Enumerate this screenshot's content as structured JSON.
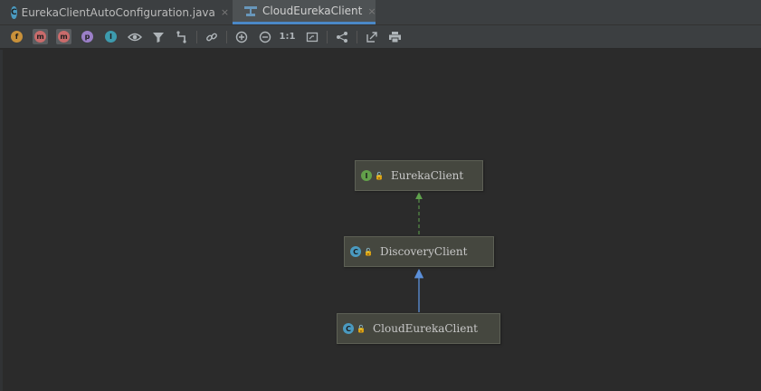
{
  "tabs": [
    {
      "label": "EurekaClientAutoConfiguration.java",
      "icon_letter": "C",
      "close": "×"
    },
    {
      "label": "CloudEurekaClient",
      "close": "×"
    }
  ],
  "toolbar": {
    "filters": [
      {
        "letter": "f",
        "color": "#c9913a"
      },
      {
        "letter": "m",
        "color": "#c96b6b"
      },
      {
        "letter": "m",
        "color": "#c96b6b"
      },
      {
        "letter": "p",
        "color": "#9b7fc8"
      },
      {
        "letter": "I",
        "color": "#3d9bae"
      }
    ],
    "actual_size_label": "1:1"
  },
  "diagram": {
    "nodes": [
      {
        "id": "EurekaClient",
        "name": "EurekaClient",
        "kind": "interface",
        "kind_letter": "I"
      },
      {
        "id": "DiscoveryClient",
        "name": "DiscoveryClient",
        "kind": "class",
        "kind_letter": "C"
      },
      {
        "id": "CloudEurekaClient",
        "name": "CloudEurekaClient",
        "kind": "class",
        "kind_letter": "C"
      }
    ],
    "edges": [
      {
        "from": "DiscoveryClient",
        "to": "EurekaClient",
        "type": "implements",
        "color": "#5fa14c"
      },
      {
        "from": "CloudEurekaClient",
        "to": "DiscoveryClient",
        "type": "extends",
        "color": "#5b8fd9"
      }
    ]
  }
}
